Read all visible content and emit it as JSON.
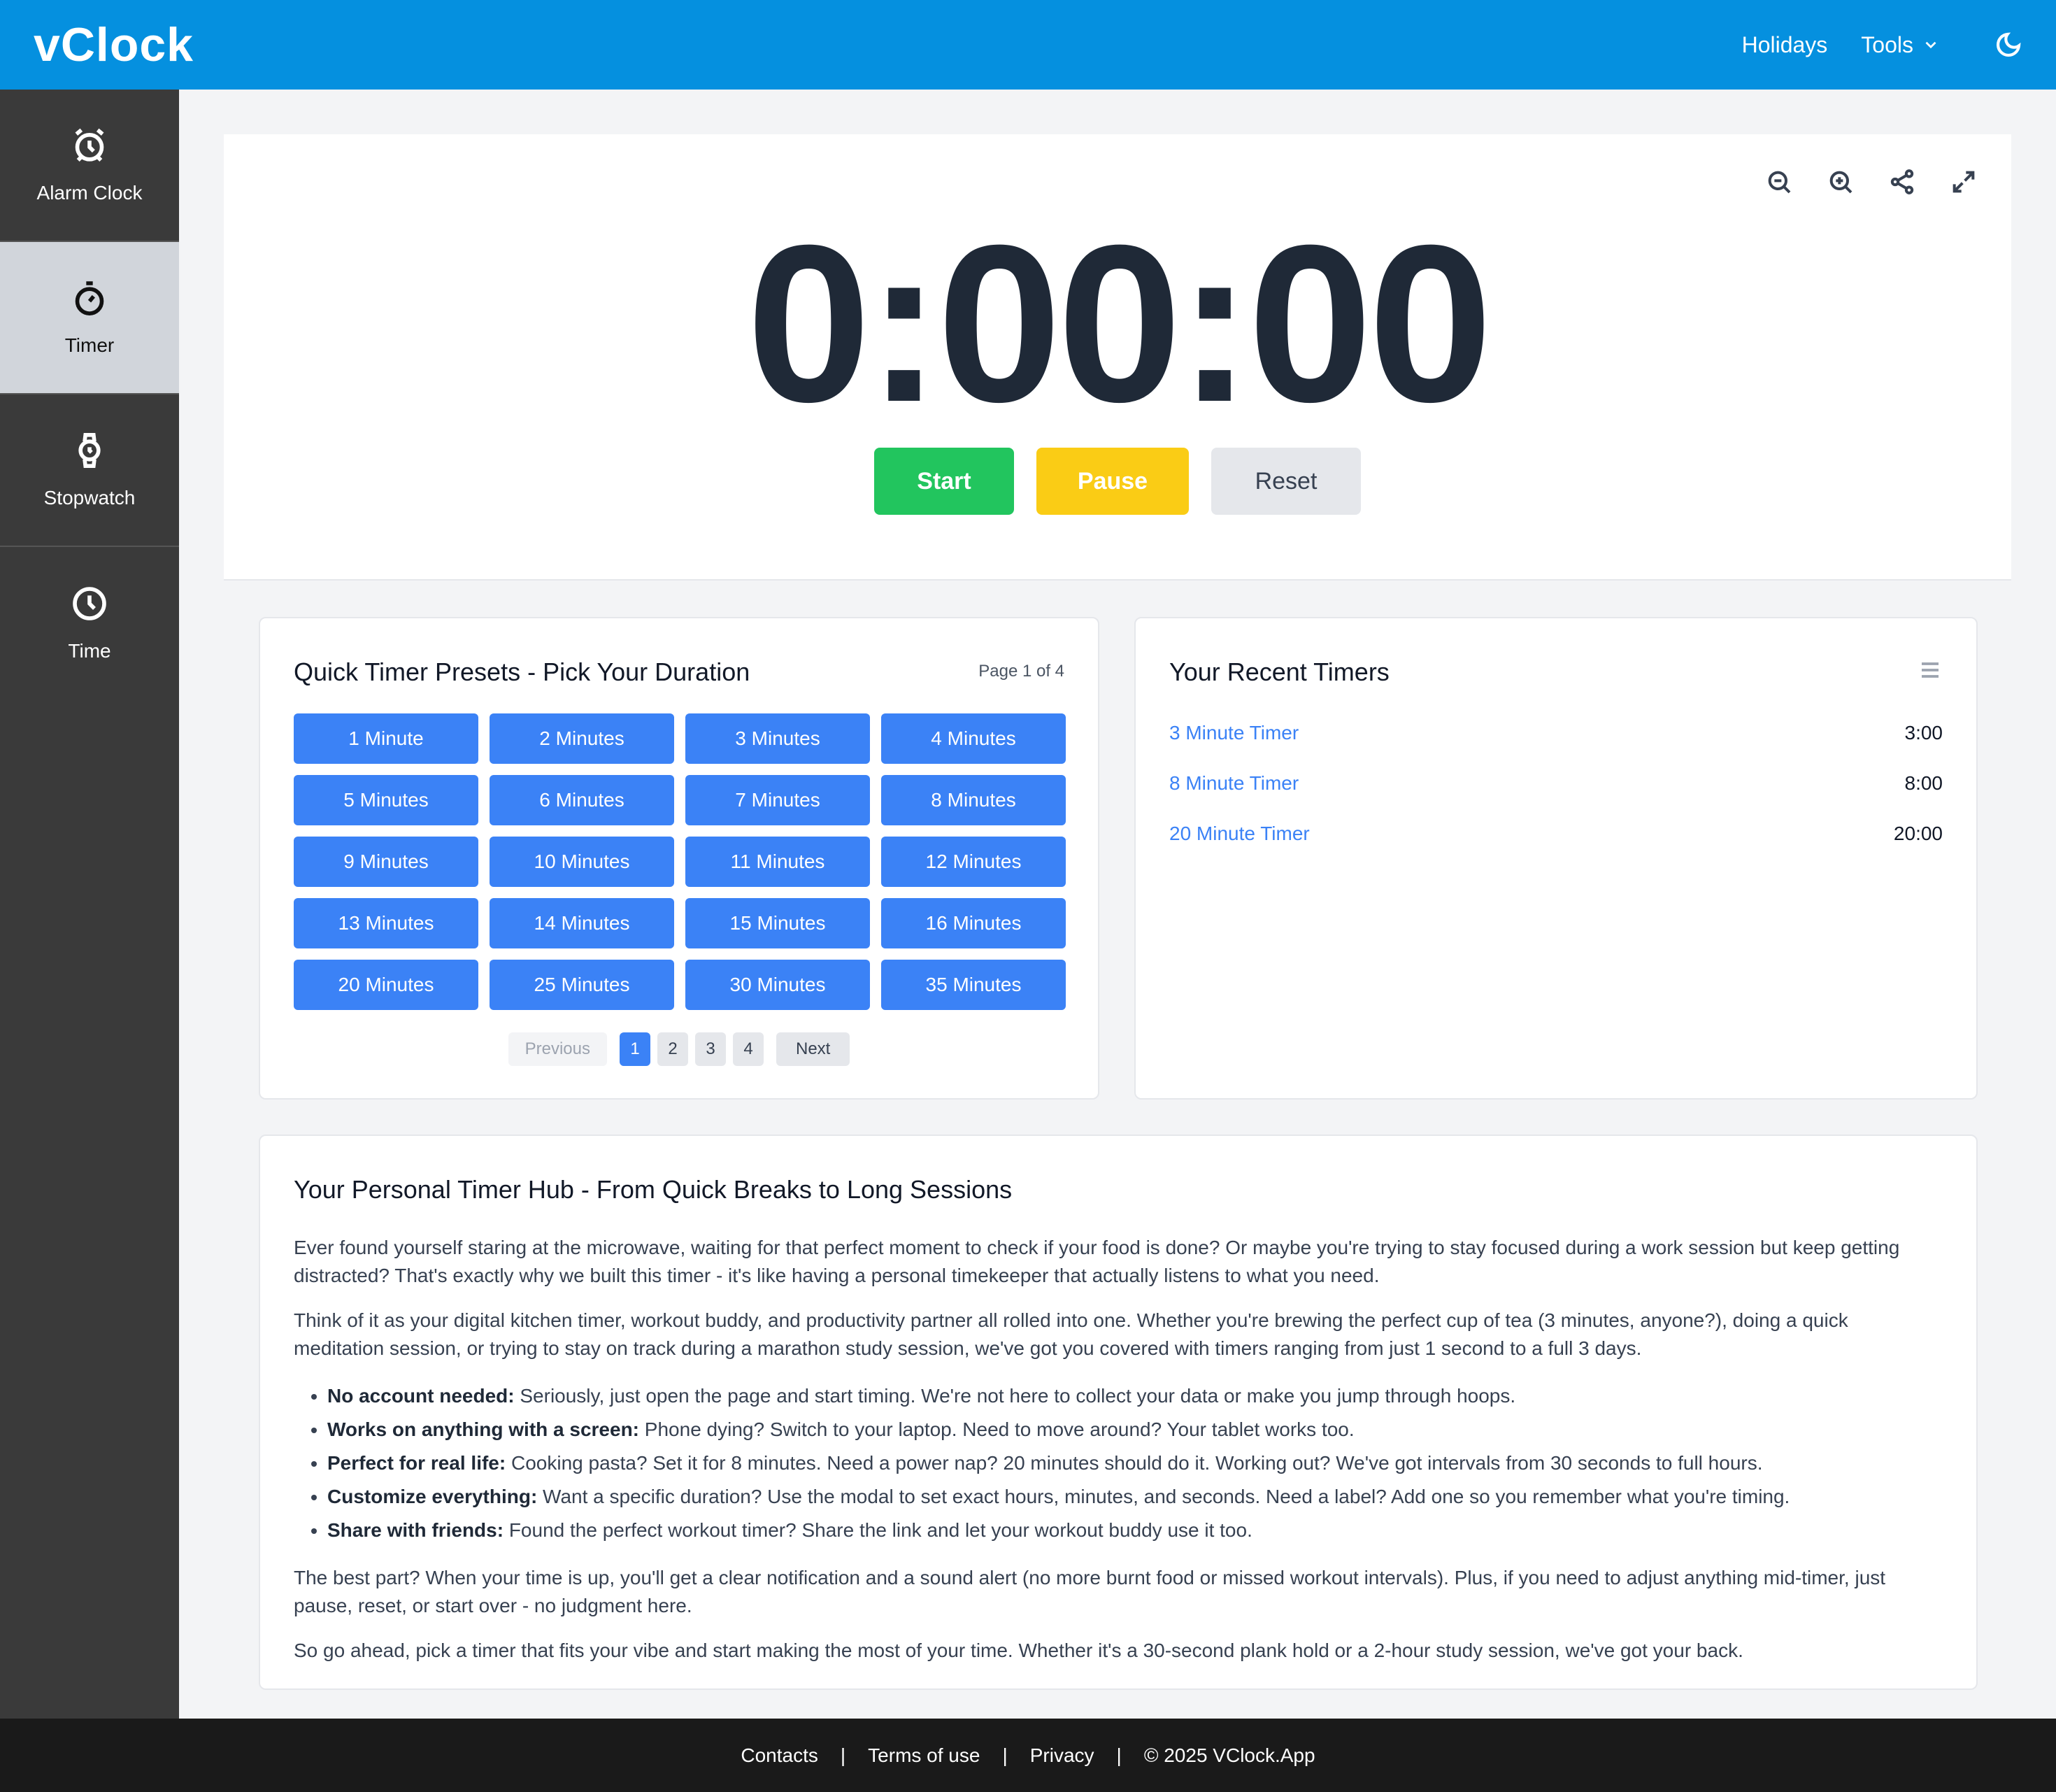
{
  "header": {
    "logo": "vClock",
    "nav": {
      "holidays": "Holidays",
      "tools": "Tools"
    }
  },
  "sidebar": {
    "items": [
      {
        "label": "Alarm Clock",
        "icon": "alarm-clock-icon"
      },
      {
        "label": "Timer",
        "icon": "timer-icon",
        "active": true
      },
      {
        "label": "Stopwatch",
        "icon": "stopwatch-icon"
      },
      {
        "label": "Time",
        "icon": "clock-icon"
      }
    ]
  },
  "timer": {
    "display": "0:00:00",
    "buttons": {
      "start": "Start",
      "pause": "Pause",
      "reset": "Reset"
    }
  },
  "presets": {
    "title": "Quick Timer Presets - Pick Your Duration",
    "page_info": "Page 1 of 4",
    "items": [
      "1 Minute",
      "2 Minutes",
      "3 Minutes",
      "4 Minutes",
      "5 Minutes",
      "6 Minutes",
      "7 Minutes",
      "8 Minutes",
      "9 Minutes",
      "10 Minutes",
      "11 Minutes",
      "12 Minutes",
      "13 Minutes",
      "14 Minutes",
      "15 Minutes",
      "16 Minutes",
      "20 Minutes",
      "25 Minutes",
      "30 Minutes",
      "35 Minutes"
    ],
    "pagination": {
      "previous": "Previous",
      "pages": [
        "1",
        "2",
        "3",
        "4"
      ],
      "next": "Next"
    }
  },
  "recent": {
    "title": "Your Recent Timers",
    "items": [
      {
        "name": "3 Minute Timer",
        "duration": "3:00"
      },
      {
        "name": "8 Minute Timer",
        "duration": "8:00"
      },
      {
        "name": "20 Minute Timer",
        "duration": "20:00"
      }
    ]
  },
  "article": {
    "title": "Your Personal Timer Hub - From Quick Breaks to Long Sessions",
    "p1": "Ever found yourself staring at the microwave, waiting for that perfect moment to check if your food is done? Or maybe you're trying to stay focused during a work session but keep getting distracted? That's exactly why we built this timer - it's like having a personal timekeeper that actually listens to what you need.",
    "p2": "Think of it as your digital kitchen timer, workout buddy, and productivity partner all rolled into one. Whether you're brewing the perfect cup of tea (3 minutes, anyone?), doing a quick meditation session, or trying to stay on track during a marathon study session, we've got you covered with timers ranging from just 1 second to a full 3 days.",
    "bullets": [
      {
        "bold": "No account needed:",
        "text": " Seriously, just open the page and start timing. We're not here to collect your data or make you jump through hoops."
      },
      {
        "bold": "Works on anything with a screen:",
        "text": " Phone dying? Switch to your laptop. Need to move around? Your tablet works too."
      },
      {
        "bold": "Perfect for real life:",
        "text": " Cooking pasta? Set it for 8 minutes. Need a power nap? 20 minutes should do it. Working out? We've got intervals from 30 seconds to full hours."
      },
      {
        "bold": "Customize everything:",
        "text": " Want a specific duration? Use the modal to set exact hours, minutes, and seconds. Need a label? Add one so you remember what you're timing."
      },
      {
        "bold": "Share with friends:",
        "text": " Found the perfect workout timer? Share the link and let your workout buddy use it too."
      }
    ],
    "p3": "The best part? When your time is up, you'll get a clear notification and a sound alert (no more burnt food or missed workout intervals). Plus, if you need to adjust anything mid-timer, just pause, reset, or start over - no judgment here.",
    "p4": "So go ahead, pick a timer that fits your vibe and start making the most of your time. Whether it's a 30-second plank hold or a 2-hour study session, we've got your back."
  },
  "footer": {
    "contacts": "Contacts",
    "terms": "Terms of use",
    "privacy": "Privacy",
    "copyright": "© 2025 VClock.App",
    "separator": "|"
  },
  "colors": {
    "header": "#0590df",
    "sidebar": "#3a3a3a",
    "start": "#22c55e",
    "pause": "#facc15",
    "preset": "#3b82f6"
  }
}
